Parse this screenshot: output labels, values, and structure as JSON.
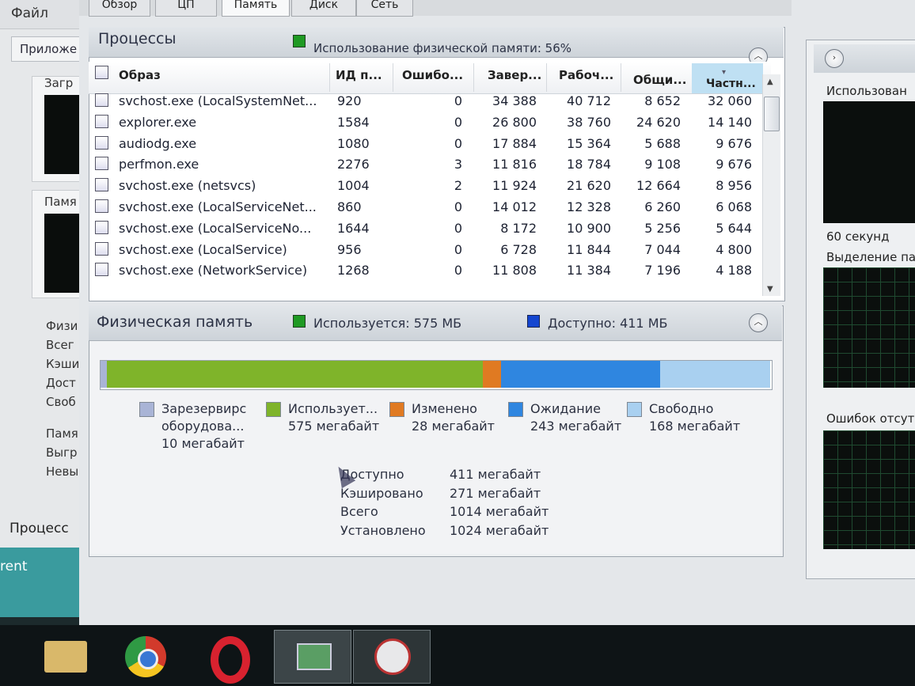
{
  "background": {
    "menu_file": "Файл",
    "tab_apps": "Приложе",
    "label_load": "Загр",
    "label_mem": "Памя",
    "stats": [
      "Физи",
      "Всег",
      "Кэши",
      "Дост",
      "Своб"
    ],
    "stats2": [
      "Памя",
      "Выгр",
      "Невы"
    ],
    "status_processes": "Процесс",
    "teal_text": "rent"
  },
  "tabs": [
    "Обзор",
    "ЦП",
    "Память",
    "Диск",
    "Сеть"
  ],
  "processes": {
    "title": "Процессы",
    "usage": "Использование физической памяти: 56%",
    "columns": [
      "Образ",
      "ИД п...",
      "Ошибо...",
      "Завер...",
      "Рабоч...",
      "Общи...",
      "Частн..."
    ],
    "rows": [
      [
        "svchost.exe (LocalSystemNet...",
        "920",
        "0",
        "34 388",
        "40 712",
        "8 652",
        "32 060"
      ],
      [
        "explorer.exe",
        "1584",
        "0",
        "26 800",
        "38 760",
        "24 620",
        "14 140"
      ],
      [
        "audiodg.exe",
        "1080",
        "0",
        "17 884",
        "15 364",
        "5 688",
        "9 676"
      ],
      [
        "perfmon.exe",
        "2276",
        "3",
        "11 816",
        "18 784",
        "9 108",
        "9 676"
      ],
      [
        "svchost.exe (netsvcs)",
        "1004",
        "2",
        "11 924",
        "21 620",
        "12 664",
        "8 956"
      ],
      [
        "svchost.exe (LocalServiceNet...",
        "860",
        "0",
        "14 012",
        "12 328",
        "6 260",
        "6 068"
      ],
      [
        "svchost.exe (LocalServiceNo...",
        "1644",
        "0",
        "8 172",
        "10 900",
        "5 256",
        "5 644"
      ],
      [
        "svchost.exe (LocalService)",
        "956",
        "0",
        "6 728",
        "11 844",
        "7 044",
        "4 800"
      ],
      [
        "svchost.exe (NetworkService)",
        "1268",
        "0",
        "11 808",
        "11 384",
        "7 196",
        "4 188"
      ]
    ]
  },
  "physical_memory": {
    "title": "Физическая память",
    "used_label": "Используется: 575 МБ",
    "available_label": "Доступно: 411 МБ",
    "colors": {
      "reserved": "#a9b4d6",
      "used": "#7fb42a",
      "modified": "#e07a22",
      "standby": "#2f86e0",
      "free": "#a9d0f0"
    },
    "bar_mb": {
      "reserved": 10,
      "used": 575,
      "modified": 28,
      "standby": 243,
      "free": 168
    },
    "legend": [
      {
        "key": "reserved",
        "line1": "Зарезервирс",
        "line2": "оборудова...",
        "line3": "10 мегабайт"
      },
      {
        "key": "used",
        "line1": "Использует...",
        "line2": "575 мегабайт"
      },
      {
        "key": "modified",
        "line1": "Изменено",
        "line2": "28 мегабайт"
      },
      {
        "key": "standby",
        "line1": "Ожидание",
        "line2": "243 мегабайт"
      },
      {
        "key": "free",
        "line1": "Свободно",
        "line2": "168 мегабайт"
      }
    ],
    "summary": [
      {
        "label": "Доступно",
        "value": "411 мегабайт"
      },
      {
        "label": "Кэшировано",
        "value": "271 мегабайт"
      },
      {
        "label": "Всего",
        "value": "1014 мегабайт"
      },
      {
        "label": "Установлено",
        "value": "1024 мегабайт"
      }
    ]
  },
  "right_panel": {
    "title": "Использован",
    "time_label": "60 секунд",
    "label2": "Выделение па",
    "label3": "Ошибок отсут"
  }
}
